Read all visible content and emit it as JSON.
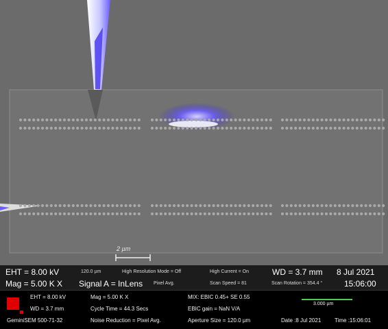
{
  "image": {
    "scale_bar_label": "2 µm"
  },
  "info_bar": {
    "eht": "EHT =  8.00 kV",
    "field": "120.0 µm",
    "hires_mode": "High Resolution Mode = Off",
    "high_current": "High Current = On",
    "wd": "WD =  3.7 mm",
    "date": "8 Jul 2021",
    "mag": "Mag =     5.00 K X",
    "signal_a": "Signal A = InLens",
    "pixel_avg": "Pixel Avg.",
    "scan_speed": "Scan Speed = 81",
    "scan_rotation": "Scan Rotation = 354.4 °",
    "time": "15:06:00"
  },
  "footer": {
    "eht": "EHT =  8.00 kV",
    "wd": "WD =  3.7 mm",
    "instrument": "GeminiSEM 500-71-32",
    "mag": "Mag =     5.00 K X",
    "cycle_time": "Cycle Time = 44.3 Secs",
    "noise_reduction": "Noise Reduction = Pixel Avg.",
    "mix": "MIX: EBIC 0.45+ SE 0.55",
    "ebic_gain": "EBIC gain = NaN V/A",
    "aperture": "Aperture Size = 120.0 µm",
    "scale_label": "3.000 µm",
    "date": "Date :8 Jul 2021",
    "time": "Time :15:06:01"
  },
  "colors": {
    "background": "#6b6b6b",
    "ebic_signal": "#6a5cff",
    "scale_line": "#4cd04c",
    "logo": "#e00000"
  }
}
